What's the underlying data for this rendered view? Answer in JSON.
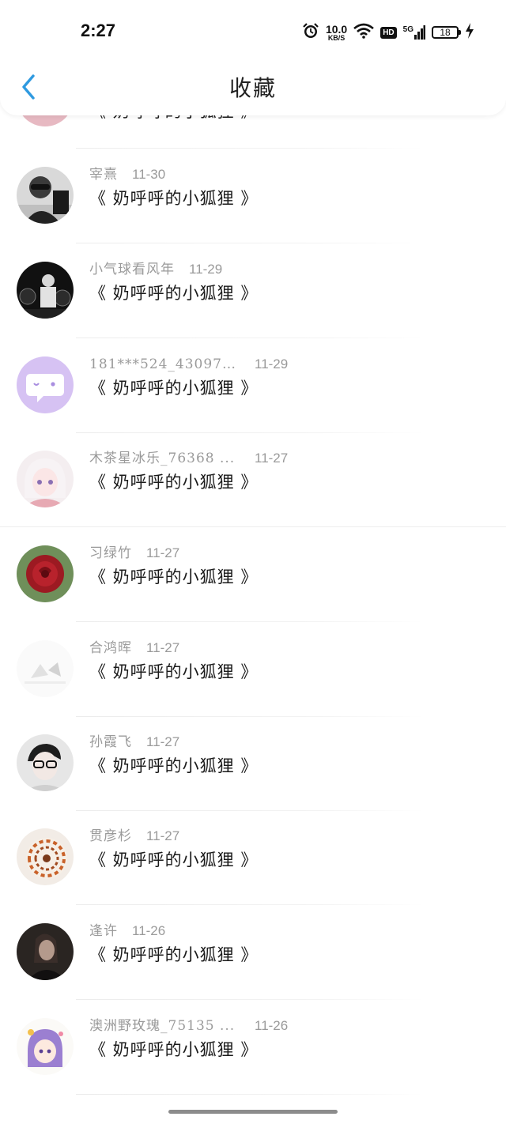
{
  "status_bar": {
    "time": "2:27",
    "net_speed_value": "10.0",
    "net_speed_unit": "KB/S",
    "hd": "HD",
    "signal": "5G",
    "battery": "18",
    "icons": [
      "alarm-icon",
      "wifi-icon",
      "signal-icon",
      "battery-icon",
      "charging-icon"
    ]
  },
  "header": {
    "title": "收藏",
    "back_icon": "chevron-left-icon",
    "accent_color": "#2f9ae0"
  },
  "list": {
    "partial_top_title": "《 奶呼呼的小狐狸 》",
    "items": [
      {
        "name": "宰熹",
        "date": "11-30",
        "title": "《 奶呼呼的小狐狸 》",
        "avatar": "person-sunglasses"
      },
      {
        "name": "小气球看风年",
        "date": "11-29",
        "title": "《 奶呼呼的小狐狸 》",
        "avatar": "drummer-stage"
      },
      {
        "name": "181***524_430975 ...",
        "date": "11-29",
        "title": "《 奶呼呼的小狐狸 》",
        "avatar": "chat-bubble-purple"
      },
      {
        "name": "木茶星冰乐_76368 ...",
        "date": "11-27",
        "title": "《 奶呼呼的小狐狸 》",
        "avatar": "anime-girl"
      },
      {
        "name": "习绿竹",
        "date": "11-27",
        "title": "《 奶呼呼的小狐狸 》",
        "avatar": "red-rose"
      },
      {
        "name": "合鸿晖",
        "date": "11-27",
        "title": "《 奶呼呼的小狐狸 》",
        "avatar": "faded-sketch"
      },
      {
        "name": "孙霞飞",
        "date": "11-27",
        "title": "《 奶呼呼的小狐狸 》",
        "avatar": "glasses-boy"
      },
      {
        "name": "贯彦杉",
        "date": "11-27",
        "title": "《 奶呼呼的小狐狸 》",
        "avatar": "nautilus-shell"
      },
      {
        "name": "逢许",
        "date": "11-26",
        "title": "《 奶呼呼的小狐狸 》",
        "avatar": "dark-portrait"
      },
      {
        "name": "澳洲野玫瑰_75135 ...",
        "date": "11-26",
        "title": "《 奶呼呼的小狐狸 》",
        "avatar": "cartoon-girl-purple"
      }
    ]
  }
}
